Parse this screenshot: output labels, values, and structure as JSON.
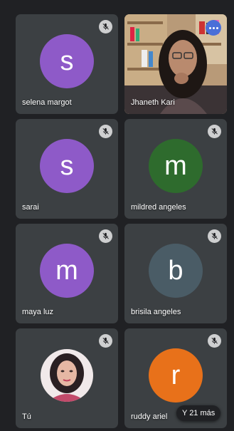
{
  "participants": [
    {
      "name": "selena margot",
      "initial": "s",
      "color": "#8e5ac8"
    },
    {
      "name": "Jhaneth Kari"
    },
    {
      "name": "sarai",
      "initial": "s",
      "color": "#8e5ac8"
    },
    {
      "name": "mildred angeles",
      "initial": "m",
      "color": "#2e6b2d"
    },
    {
      "name": "maya luz",
      "initial": "m",
      "color": "#8e5ac8"
    },
    {
      "name": "brisila angeles",
      "initial": "b",
      "color": "#4a5c66"
    },
    {
      "name": "Tú"
    },
    {
      "name": "ruddy ariel",
      "initial": "r",
      "color": "#e8711a"
    }
  ],
  "more_label": "Y 21 más"
}
